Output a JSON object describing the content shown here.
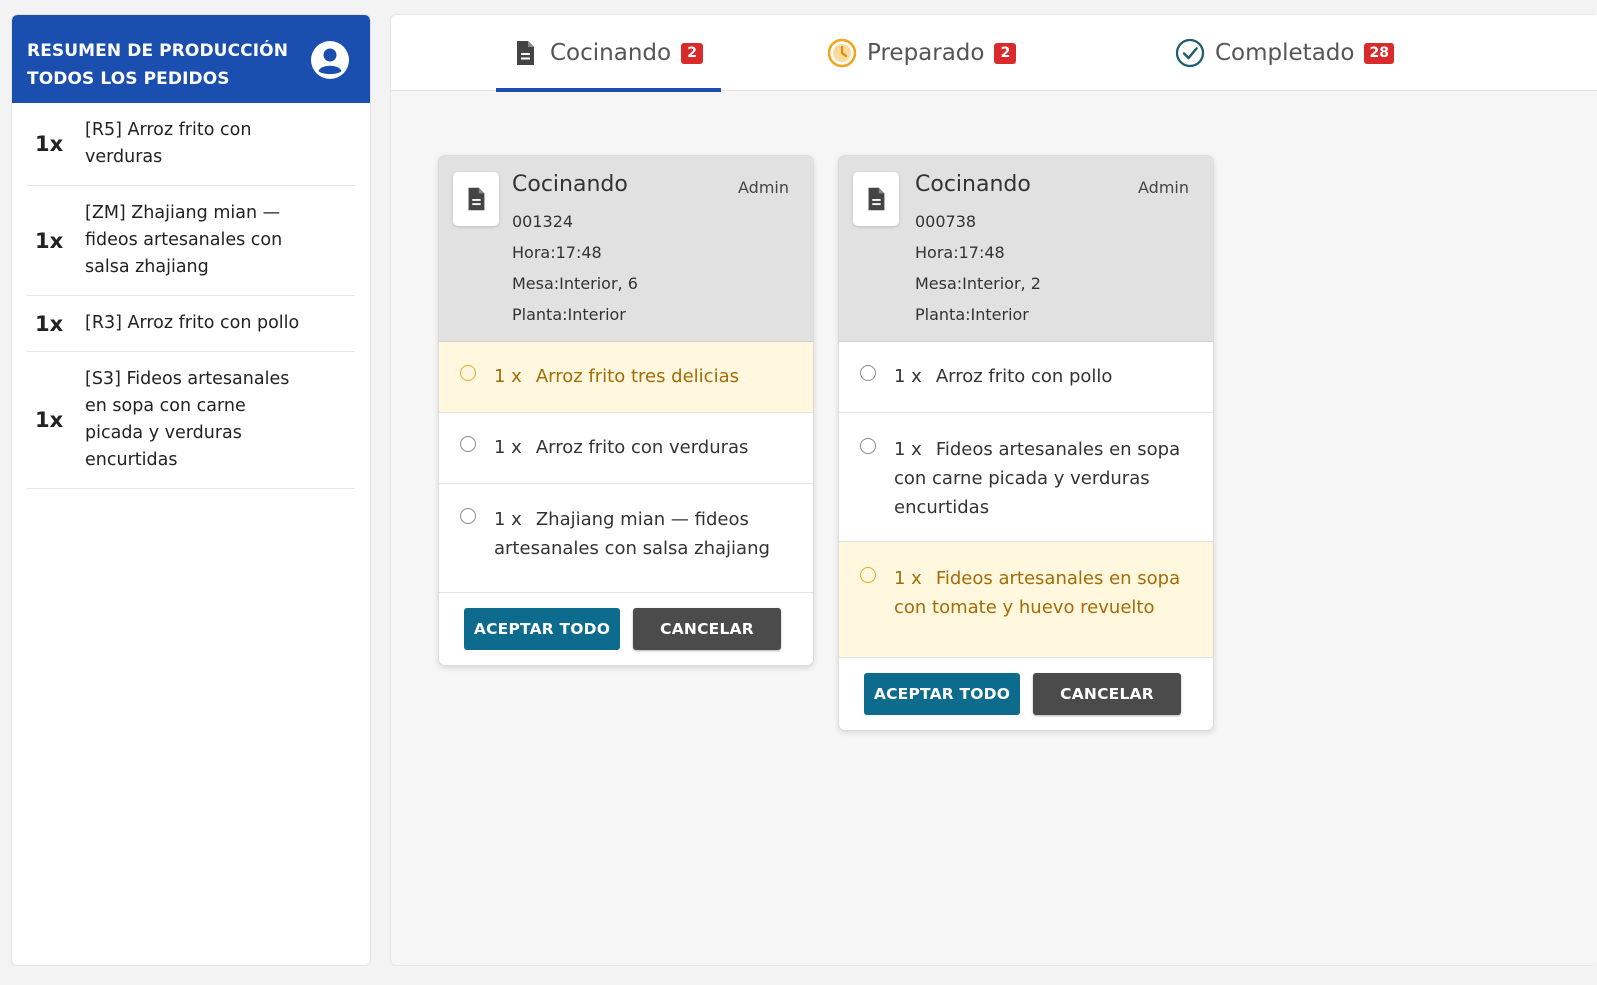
{
  "sidebar": {
    "title_line1": "RESUMEN DE PRODUCCIÓN",
    "title_line2": "TODOS LOS PEDIDOS",
    "items": [
      {
        "qty": "1x",
        "name": "[R5] Arroz frito con verduras"
      },
      {
        "qty": "1x",
        "name": "[ZM] Zhajiang mian — fideos artesanales con salsa zhajiang"
      },
      {
        "qty": "1x",
        "name": "[R3] Arroz frito con pollo"
      },
      {
        "qty": "1x",
        "name": "[S3] Fideos artesanales en sopa con carne picada y verduras encurtidas"
      }
    ]
  },
  "tabs": [
    {
      "label": "Cocinando",
      "count": "2",
      "icon": "document-icon",
      "active": true
    },
    {
      "label": "Preparado",
      "count": "2",
      "icon": "clock-icon",
      "active": false
    },
    {
      "label": "Completado",
      "count": "28",
      "icon": "check-circle-icon",
      "active": false
    }
  ],
  "orders": [
    {
      "status": "Cocinando",
      "user": "Admin",
      "number": "001324",
      "hora": "Hora:17:48",
      "mesa": "Mesa:Interior, 6",
      "planta": "Planta:Interior",
      "items": [
        {
          "qty": "1 x",
          "name": "Arroz frito tres delicias",
          "highlight": true
        },
        {
          "qty": "1 x",
          "name": "Arroz frito con verduras",
          "highlight": false
        },
        {
          "qty": "1 x",
          "name": "Zhajiang mian — fideos artesanales con salsa zhajiang",
          "highlight": false
        }
      ],
      "accept_label": "ACEPTAR TODO",
      "cancel_label": "CANCELAR"
    },
    {
      "status": "Cocinando",
      "user": "Admin",
      "number": "000738",
      "hora": "Hora:17:48",
      "mesa": "Mesa:Interior, 2",
      "planta": "Planta:Interior",
      "items": [
        {
          "qty": "1 x",
          "name": "Arroz frito con pollo",
          "highlight": false
        },
        {
          "qty": "1 x",
          "name": "Fideos artesanales en sopa con carne picada y verduras encurtidas",
          "highlight": false
        },
        {
          "qty": "1 x",
          "name": "Fideos artesanales en sopa con tomate y huevo revuelto",
          "highlight": true
        }
      ],
      "accept_label": "ACEPTAR TODO",
      "cancel_label": "CANCELAR"
    }
  ],
  "colors": {
    "brand": "#1a4fb0",
    "accept": "#0d6b8e",
    "cancel": "#4b4b4b",
    "badge": "#d82b2b",
    "highlight_bg": "#fff7de",
    "highlight_text": "#a46b06",
    "clock": "#f0a51c",
    "check": "#1f5e6e"
  }
}
